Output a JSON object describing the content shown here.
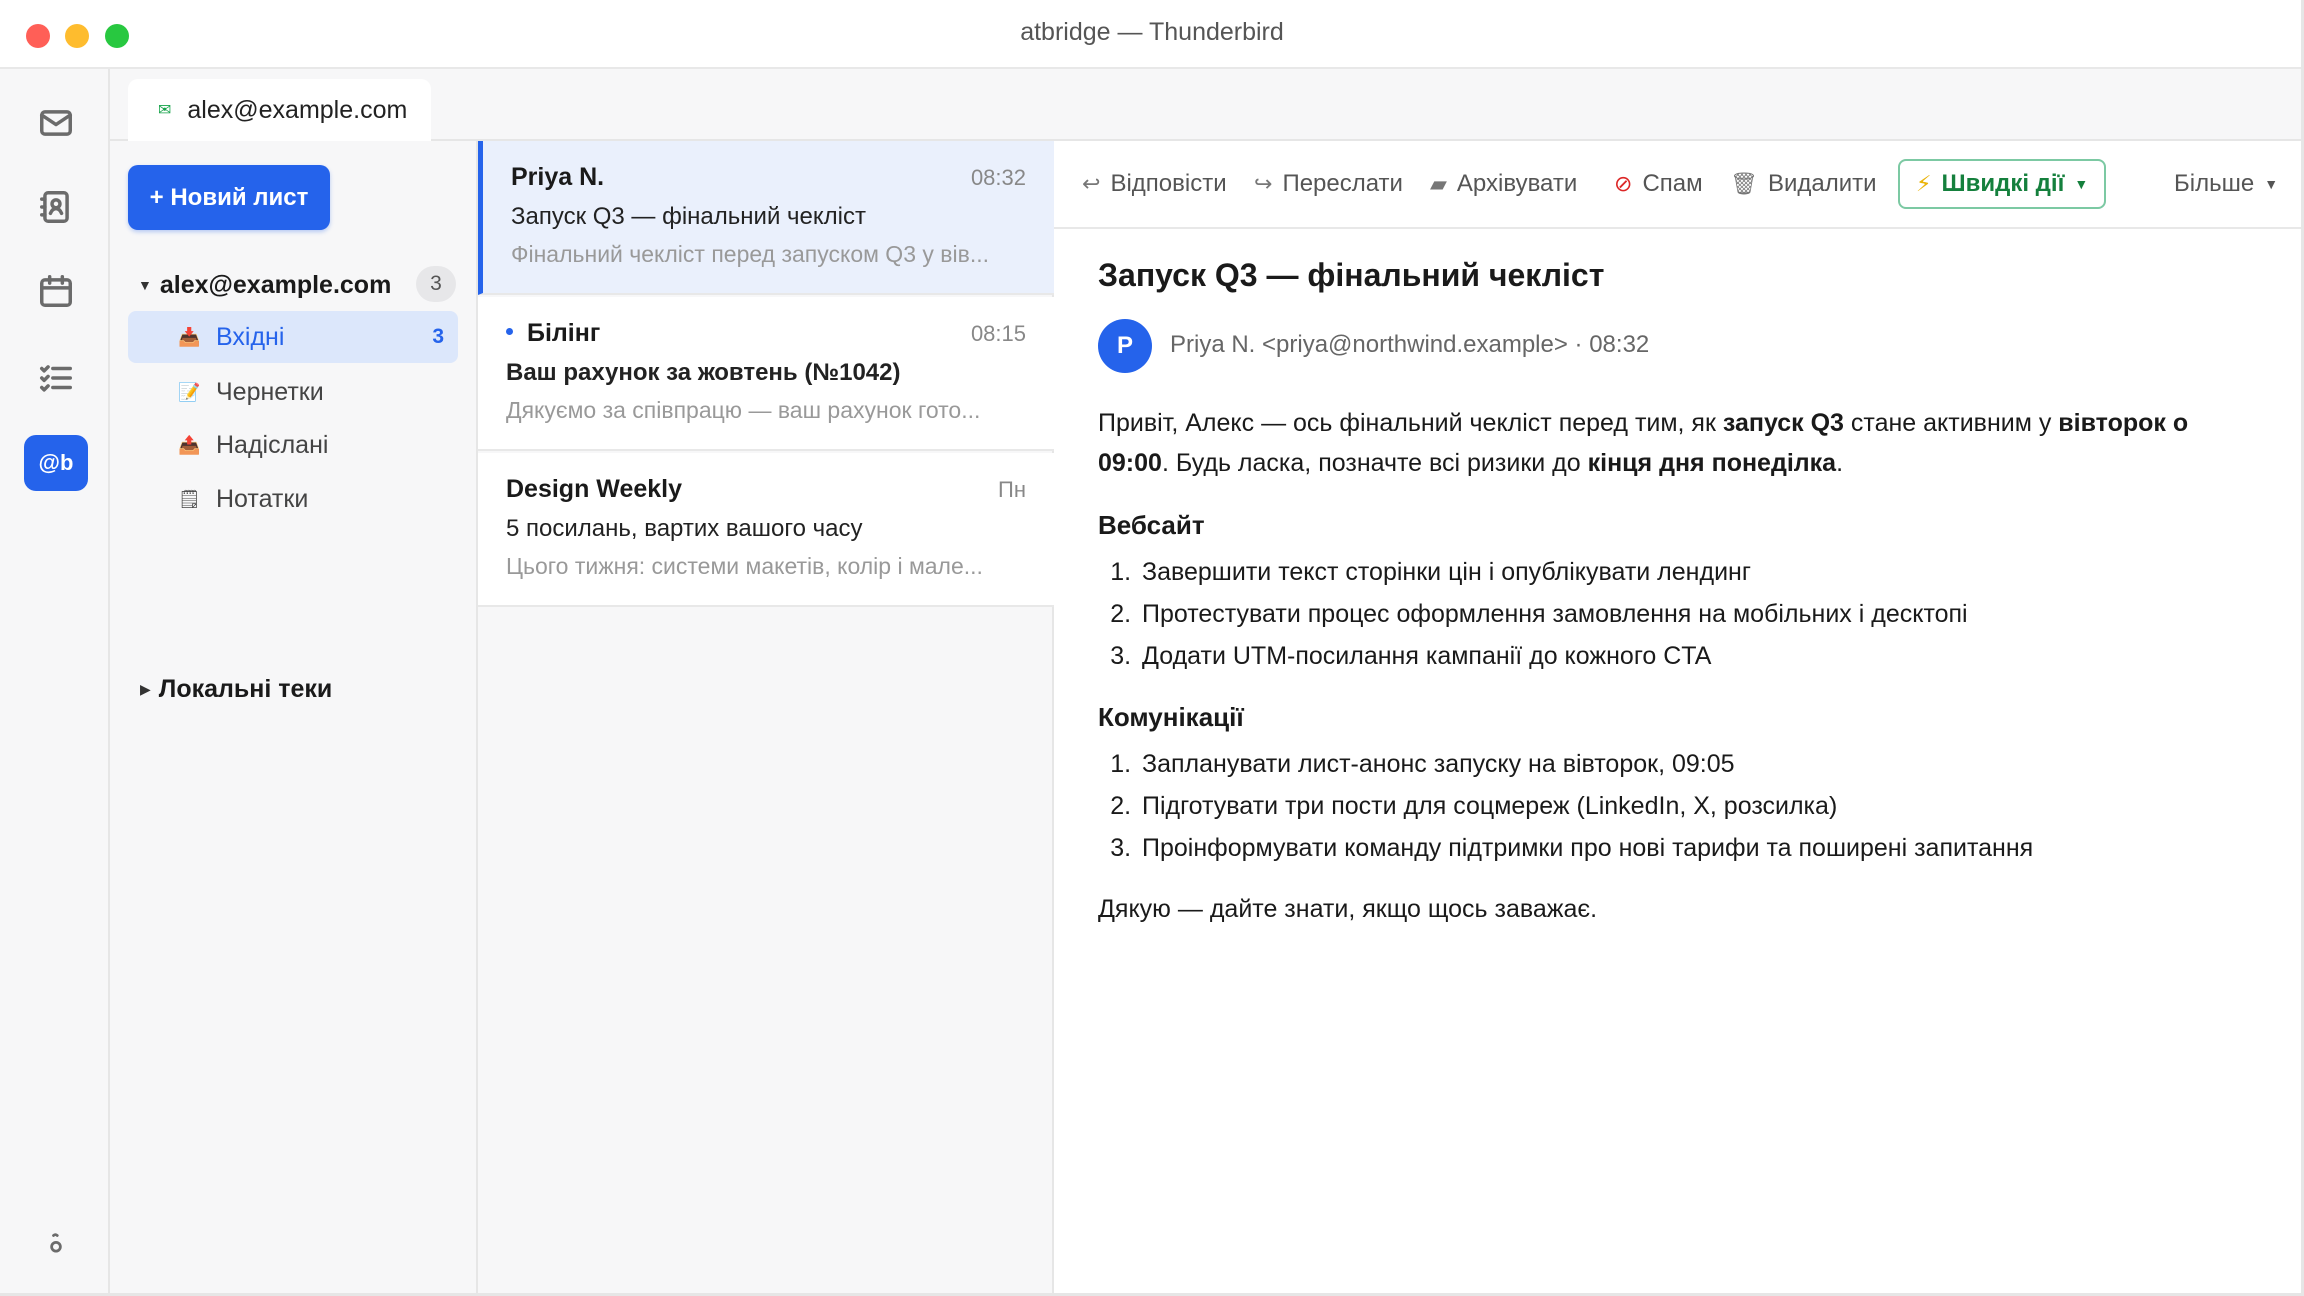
{
  "window": {
    "title": "atbridge — Thunderbird"
  },
  "rail": {
    "icons": [
      "mail-icon",
      "address-book-icon",
      "calendar-icon",
      "tasks-icon",
      "atbridge-icon",
      "settings-icon"
    ],
    "active_label": "@b"
  },
  "tab": {
    "label": "alex@example.com"
  },
  "folders": {
    "compose_label": "+ Новий лист",
    "account": "alex@example.com",
    "account_count": "3",
    "items": [
      {
        "label": "Вхідні",
        "count": "3",
        "icon": "inbox-icon"
      },
      {
        "label": "Чернетки",
        "count": "",
        "icon": "drafts-icon"
      },
      {
        "label": "Надіслані",
        "count": "",
        "icon": "sent-icon"
      },
      {
        "label": "Нотатки",
        "count": "",
        "icon": "notes-icon"
      }
    ],
    "local_label": "Локальні теки"
  },
  "messages": [
    {
      "from": "Priya N.",
      "time": "08:32",
      "subject": "Запуск Q3 — фінальний чекліст",
      "preview": "Фінальний чекліст перед запуском Q3 у вів..."
    },
    {
      "from": "Білінг",
      "time": "08:15",
      "subject": "Ваш рахунок за жовтень (№1042)",
      "preview": "Дякуємо за співпрацю — ваш рахунок гото..."
    },
    {
      "from": "Design Weekly",
      "time": "Пн",
      "subject": "5 посилань, вартих вашого часу",
      "preview": "Цього тижня: системи макетів, колір і мале..."
    }
  ],
  "toolbar": {
    "reply": "Відповісти",
    "forward": "Переслати",
    "archive": "Архівувати",
    "spam": "Спам",
    "delete": "Видалити",
    "quick": "Швидкі дії",
    "more": "Більше"
  },
  "reader": {
    "subject": "Запуск Q3 — фінальний чекліст",
    "avatar": "P",
    "sender": "Priya N. <priya@northwind.example> · 08:32",
    "intro": {
      "t1": "Привіт, Алекс — ось фінальний чекліст перед тим, як ",
      "b1": "запуск Q3",
      "t2": " стане активним у ",
      "b2": "вівторок о 09:00",
      "t3": ". Будь ласка, позначте всі ризики до ",
      "b3": "кінця дня понеділка",
      "t4": "."
    },
    "section1": {
      "heading": "Вебсайт",
      "items": [
        "Завершити текст сторінки цін і опублікувати лендинг",
        "Протестувати процес оформлення замовлення на мобільних і десктопі",
        "Додати UTM-посилання кампанії до кожного CTA"
      ]
    },
    "section2": {
      "heading": "Комунікації",
      "items": [
        "Запланувати лист-анонс запуску на вівторок, 09:05",
        "Підготувати три пости для соцмереж (LinkedIn, X, розсилка)",
        "Проінформувати команду підтримки про нові тарифи та поширені запитання"
      ]
    },
    "closing": "Дякую — дайте знати, якщо щось заважає."
  }
}
